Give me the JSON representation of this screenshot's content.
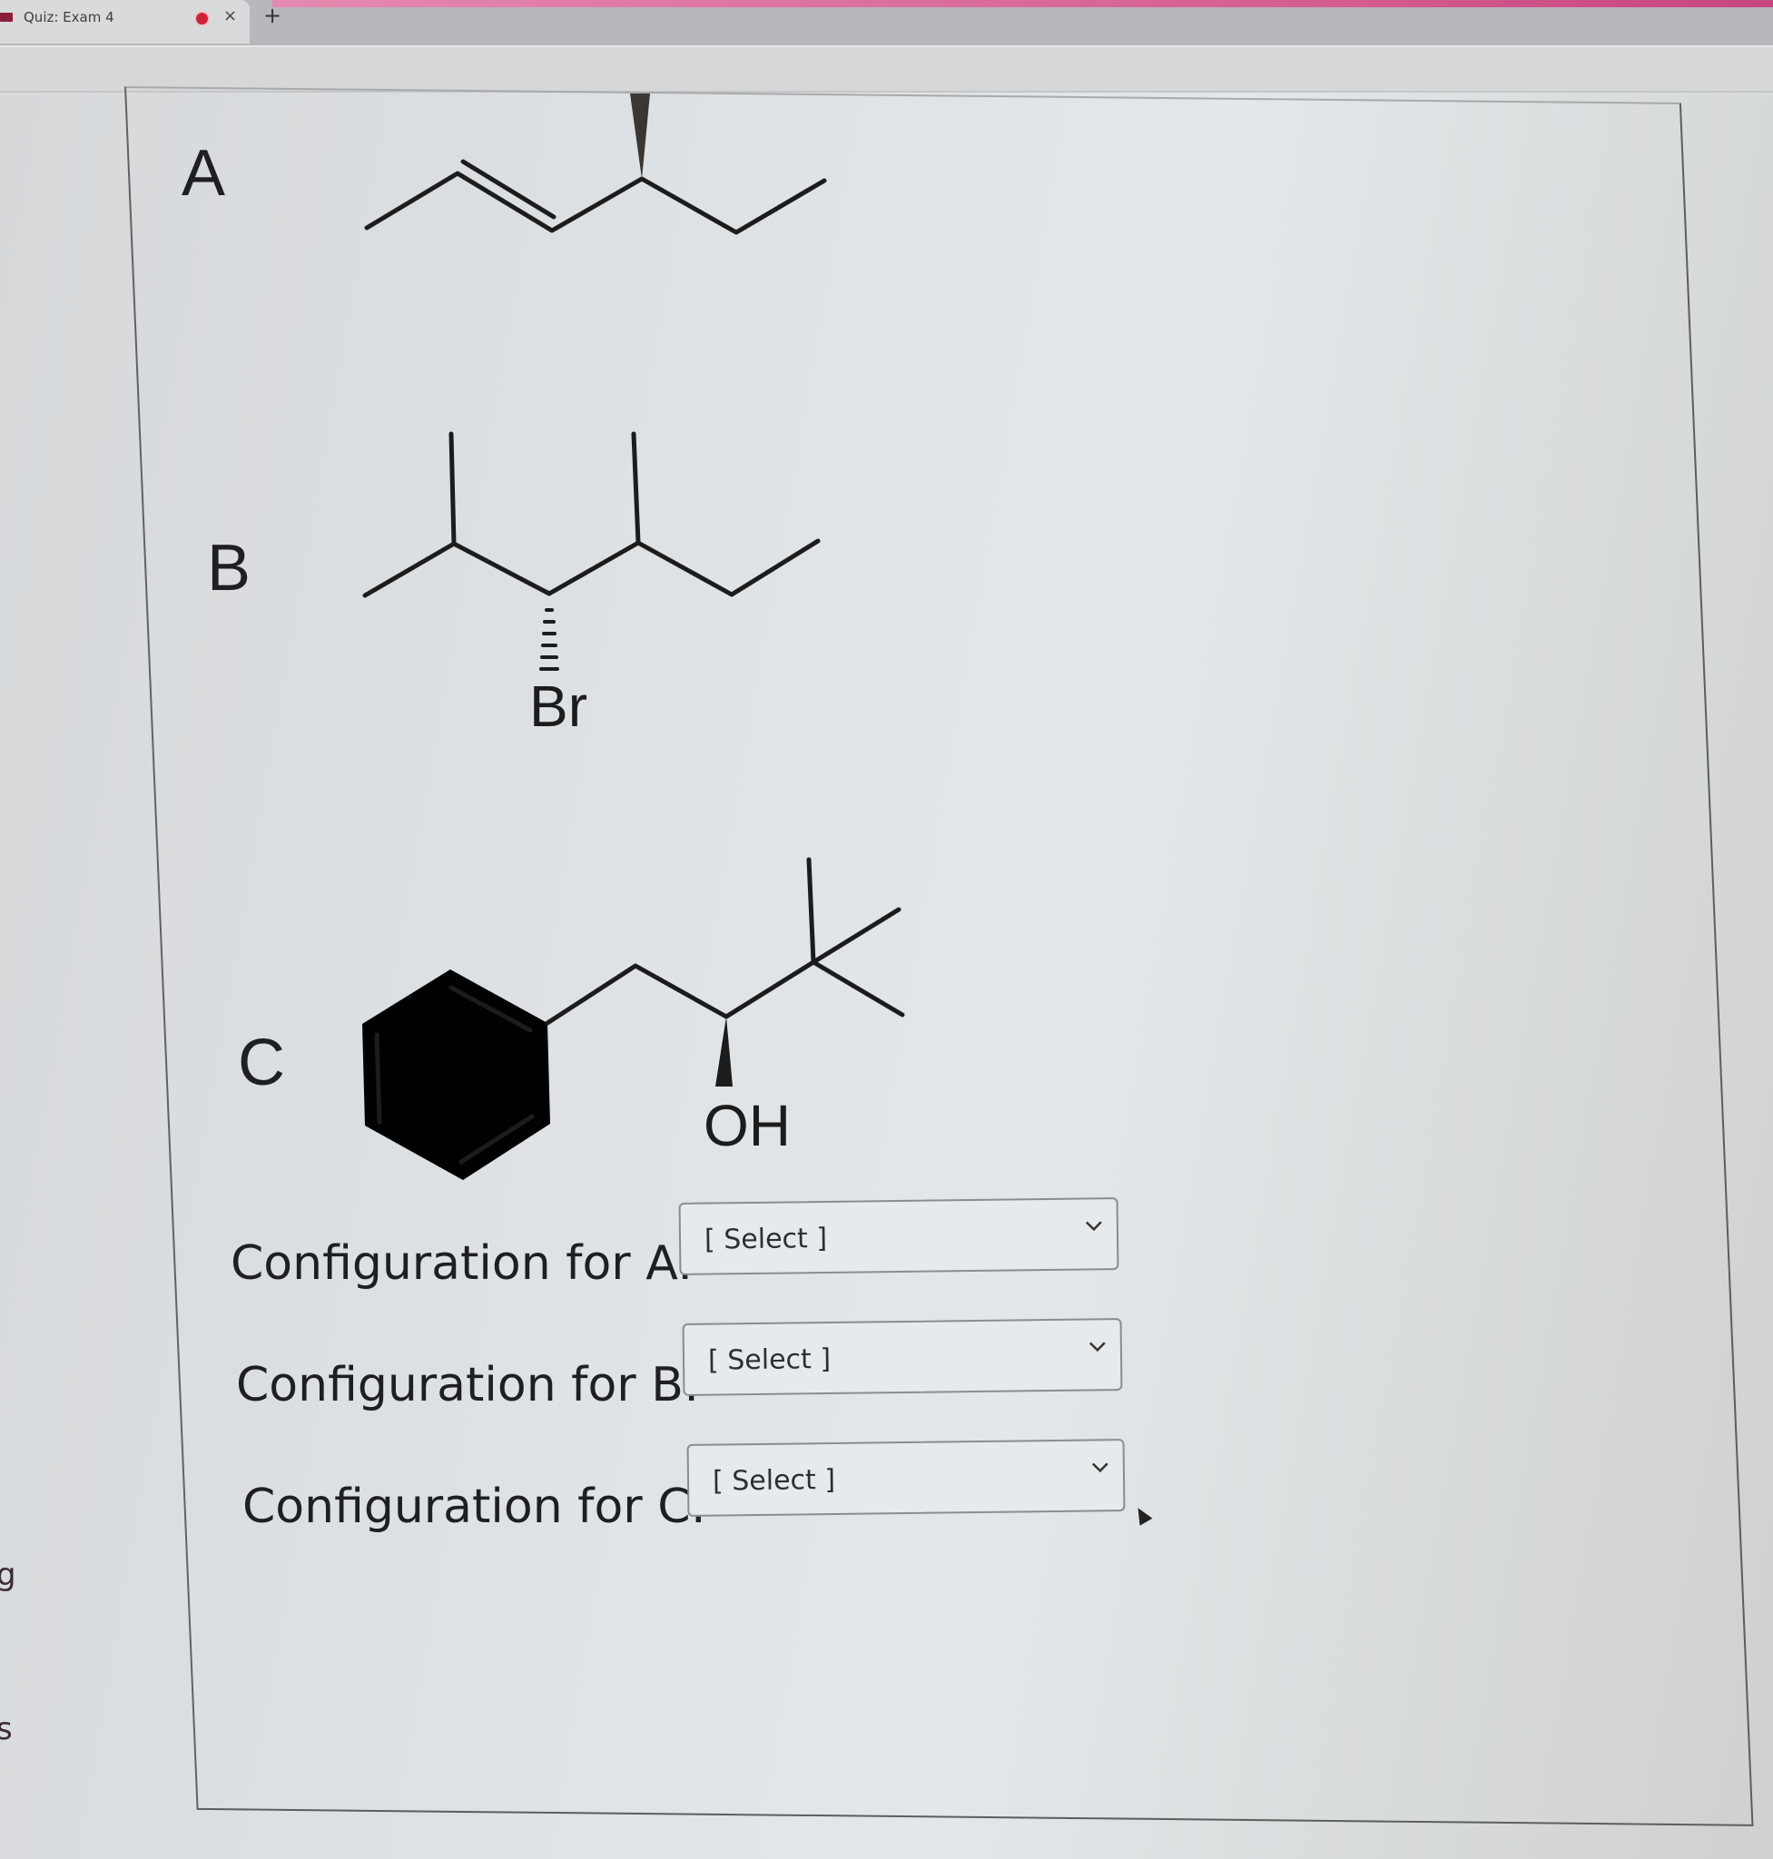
{
  "browser": {
    "tab_title": "Quiz: Exam 4",
    "tab_icons": [
      "favicon-icon",
      "recording-indicator-icon",
      "close-icon"
    ],
    "new_tab_label": "+",
    "close_label": "×"
  },
  "sidebar_fragments": [
    "g",
    "s"
  ],
  "question": {
    "structures": [
      {
        "label": "A",
        "description": "hex-2-ene with wedge methyl at C4",
        "wedge": "solid"
      },
      {
        "label": "B",
        "description": "3-bromo-2,4-dimethylhexane skeleton with hashed Br",
        "substituent": "Br",
        "wedge": "hashed"
      },
      {
        "label": "C",
        "description": "benzyl chain with wedged OH and tert-butyl group",
        "substituent": "OH",
        "wedge": "solid"
      }
    ],
    "dropdowns": [
      {
        "label": "Configuration for A:",
        "value": "[ Select ]"
      },
      {
        "label": "Configuration for B:",
        "value": "[ Select ]"
      },
      {
        "label": "Configuration for C:",
        "value": "[ Select ]"
      }
    ]
  }
}
